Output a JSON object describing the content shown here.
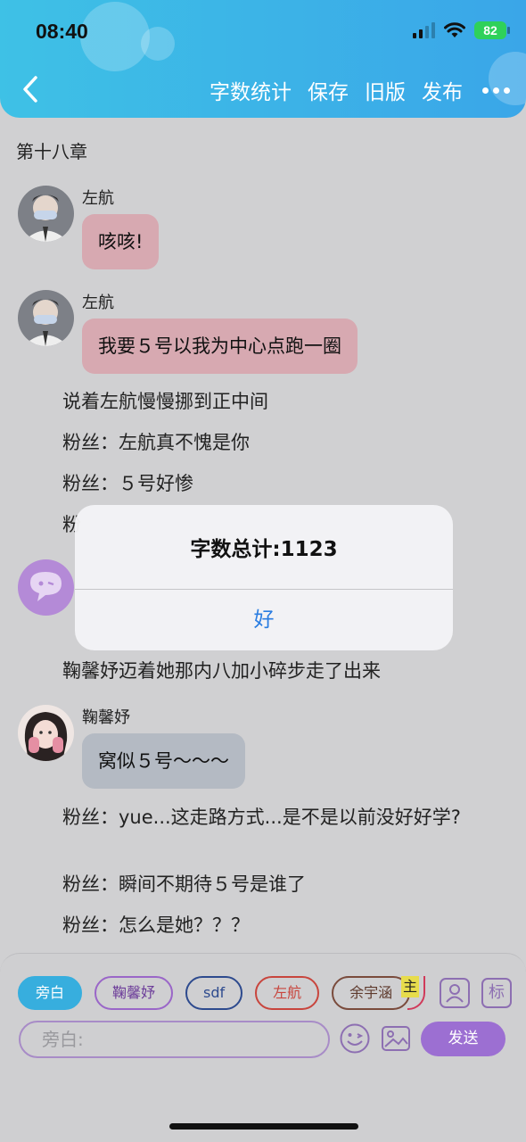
{
  "status_bar": {
    "time": "08:40",
    "battery": "82"
  },
  "header": {
    "actions": [
      "字数统计",
      "保存",
      "旧版",
      "发布"
    ],
    "accent_color": "#3ab1e6"
  },
  "chapter_title": "第十八章",
  "messages": [
    {
      "sender": "左航",
      "text": "咳咳!",
      "bubble_color": "#d7a9b1"
    },
    {
      "sender": "左航",
      "text": "我要５号以我为中心点跑一圈",
      "bubble_color": "#d7a9b1"
    },
    {
      "sender": "鞠馨妤",
      "text": "窝似５号～～～",
      "bubble_color": "#b4bac3"
    }
  ],
  "narration": [
    "说着左航慢慢挪到正中间",
    "粉丝：左航真不愧是你",
    "粉丝：５号好惨",
    "粉",
    "鞠馨妤迈着她那内八加小碎步走了出来",
    "粉丝：yue...这走路方式...是不是以前没好好学?",
    "粉丝：瞬间不期待５号是谁了",
    "粉丝：怎么是她？？？"
  ],
  "dialog": {
    "title": "字数总计:1123",
    "ok_label": "好"
  },
  "composer": {
    "roles": [
      "旁白",
      "鞠馨妤",
      "sdf",
      "左航",
      "余宇涵"
    ],
    "partial_role_char": "主",
    "placeholder": "旁白:",
    "send_label": "发送",
    "mark_icon_label": "标"
  }
}
